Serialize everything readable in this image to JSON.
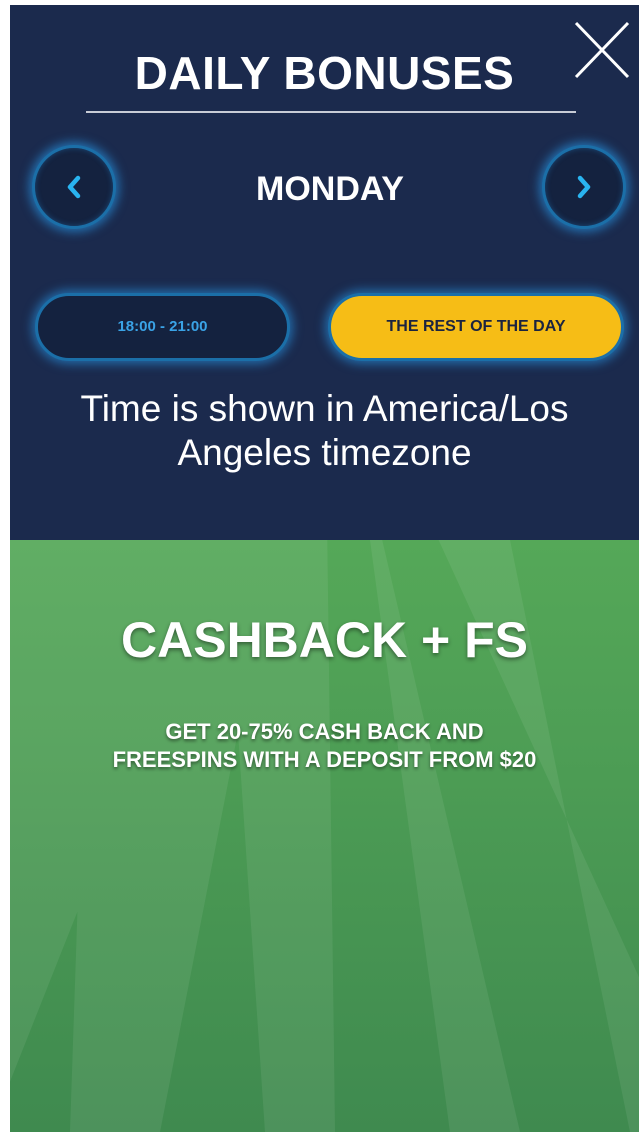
{
  "header": {
    "title": "DAILY BONUSES"
  },
  "icons": {
    "close": "close-icon",
    "prev": "chevron-left-icon",
    "next": "chevron-right-icon"
  },
  "day_nav": {
    "day": "MONDAY"
  },
  "time_tabs": [
    {
      "label": "18:00 - 21:00",
      "selected": false
    },
    {
      "label": "THE REST OF THE DAY",
      "selected": true
    }
  ],
  "timezone_note": "Time is shown in America/Los Angeles timezone",
  "bonus": {
    "title": "CASHBACK + FS",
    "description_lines": [
      "GET 20-75% CASH BACK AND",
      "FREESPINS WITH A DEPOSIT FROM $20"
    ]
  },
  "colors": {
    "panel_bg": "#1b2a4d",
    "accent_blue": "#1b6fa8",
    "active_tab": "#f6bd16",
    "bonus_green": "#4f9e52"
  }
}
